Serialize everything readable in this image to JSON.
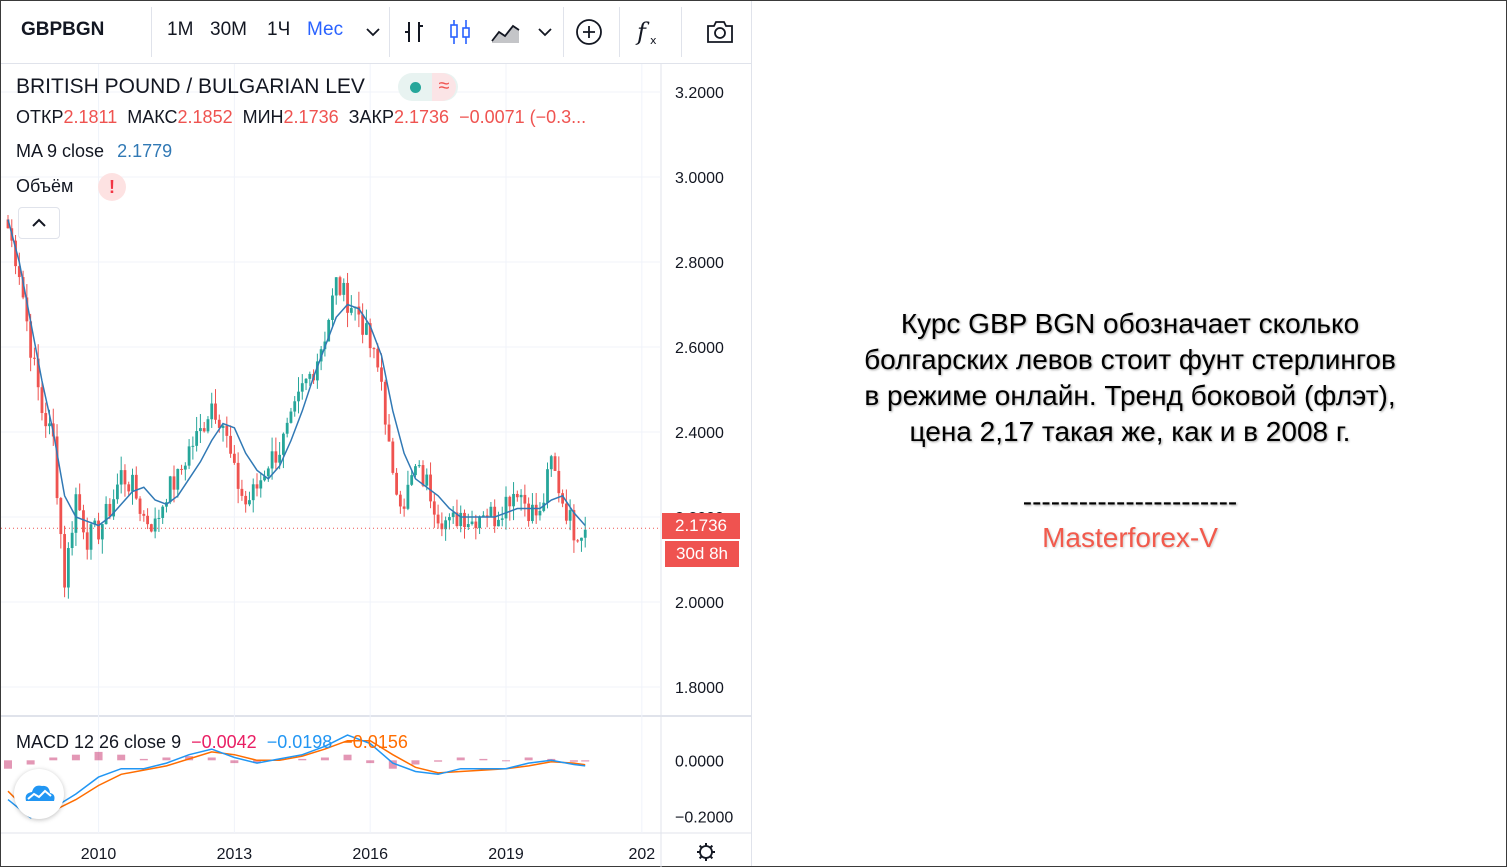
{
  "toolbar": {
    "symbol": "GBPBGN",
    "intervals": [
      "1М",
      "30М",
      "1Ч",
      "Мес"
    ],
    "active_interval": "Мес",
    "icons": [
      "chevron-down-icon",
      "bar-chart-icon",
      "candles-icon",
      "area-chart-icon",
      "chevron-down-icon",
      "add-compare-icon",
      "indicators-fx-icon",
      "camera-icon"
    ]
  },
  "legend": {
    "title": "BRITISH POUND / BULGARIAN LEV",
    "ohlc": [
      {
        "label": "ОТКР",
        "value": "2.1811"
      },
      {
        "label": "МАКС",
        "value": "2.1852"
      },
      {
        "label": "МИН",
        "value": "2.1736"
      },
      {
        "label": "ЗАКР",
        "value": "2.1736"
      }
    ],
    "change": "−0.0071 (−0.3...",
    "ma_label": "MA 9 close",
    "ma_value": "2.1779",
    "volume_label": "Объём",
    "macd_label": "MACD 12 26 close 9",
    "macd_hist": "−0.0042",
    "macd_line": "−0.0198",
    "macd_signal": "−0.0156"
  },
  "price_scale": {
    "labels": [
      "3.2000",
      "3.0000",
      "2.8000",
      "2.6000",
      "2.4000",
      "2.2000",
      "2.0000",
      "1.8000"
    ],
    "last_price": "2.1736",
    "countdown": "30d 8h"
  },
  "macd_scale": {
    "labels": [
      "0.0000",
      "−0.2000"
    ]
  },
  "time_axis": {
    "labels": [
      "2010",
      "2013",
      "2016",
      "2019",
      "202"
    ]
  },
  "colors": {
    "up": "#26a69a",
    "down": "#ef5350",
    "ma": "#3179b5",
    "macd": "#2196f3",
    "signal": "#ff6d00",
    "hist": "#c2185b",
    "brand": "#f25a4c"
  },
  "annotation": {
    "lines": [
      "Курс GBP BGN обозначает сколько",
      "болгарских левов стоит фунт стерлингов",
      "в режиме онлайн. Тренд боковой (флэт),",
      "цена 2,17 такая же, как и в 2008 г."
    ],
    "dashes": "-----------------------",
    "brand": "Masterforex-V"
  },
  "chart_data": [
    {
      "type": "line",
      "description": "Monthly close of GBP/BGN (candlestick chart, approximated), with MA 9 close",
      "x_range": [
        2007.9,
        2020.75
      ],
      "ylim": [
        1.74,
        3.34
      ],
      "x": [
        2008.0,
        2008.25,
        2008.5,
        2008.75,
        2009.0,
        2009.25,
        2009.5,
        2009.75,
        2010.0,
        2010.25,
        2010.5,
        2010.75,
        2011.0,
        2011.25,
        2011.5,
        2011.75,
        2012.0,
        2012.25,
        2012.5,
        2012.75,
        2013.0,
        2013.25,
        2013.5,
        2013.75,
        2014.0,
        2014.25,
        2014.5,
        2014.75,
        2015.0,
        2015.25,
        2015.5,
        2015.75,
        2016.0,
        2016.25,
        2016.5,
        2016.75,
        2017.0,
        2017.25,
        2017.5,
        2017.75,
        2018.0,
        2018.25,
        2018.5,
        2018.75,
        2019.0,
        2019.25,
        2019.5,
        2019.75,
        2020.0,
        2020.25,
        2020.5,
        2020.75
      ],
      "close": [
        2.88,
        2.78,
        2.6,
        2.45,
        2.38,
        2.05,
        2.25,
        2.15,
        2.17,
        2.22,
        2.3,
        2.27,
        2.2,
        2.18,
        2.26,
        2.29,
        2.36,
        2.4,
        2.47,
        2.42,
        2.3,
        2.23,
        2.27,
        2.33,
        2.36,
        2.42,
        2.5,
        2.55,
        2.63,
        2.75,
        2.71,
        2.68,
        2.6,
        2.52,
        2.28,
        2.24,
        2.31,
        2.28,
        2.21,
        2.18,
        2.21,
        2.19,
        2.22,
        2.2,
        2.24,
        2.27,
        2.22,
        2.2,
        2.33,
        2.24,
        2.17,
        2.17
      ],
      "ma": [
        2.9,
        2.8,
        2.66,
        2.52,
        2.4,
        2.25,
        2.2,
        2.19,
        2.18,
        2.2,
        2.23,
        2.26,
        2.27,
        2.24,
        2.23,
        2.25,
        2.29,
        2.33,
        2.38,
        2.42,
        2.41,
        2.35,
        2.31,
        2.29,
        2.32,
        2.38,
        2.45,
        2.53,
        2.6,
        2.67,
        2.7,
        2.69,
        2.65,
        2.58,
        2.45,
        2.35,
        2.29,
        2.27,
        2.25,
        2.22,
        2.2,
        2.2,
        2.2,
        2.2,
        2.21,
        2.22,
        2.22,
        2.22,
        2.24,
        2.25,
        2.21,
        2.18
      ],
      "last_price": 2.1736
    },
    {
      "type": "line",
      "description": "MACD 12 26 close 9 (approximated)",
      "ylim": [
        -0.235,
        0.09
      ],
      "x": [
        2008.0,
        2008.5,
        2009.0,
        2009.5,
        2010.0,
        2010.5,
        2011.0,
        2011.5,
        2012.0,
        2012.5,
        2013.0,
        2013.5,
        2014.0,
        2014.5,
        2015.0,
        2015.5,
        2016.0,
        2016.5,
        2017.0,
        2017.5,
        2018.0,
        2018.5,
        2019.0,
        2019.5,
        2020.0,
        2020.5,
        2020.75
      ],
      "macd": [
        -0.14,
        -0.205,
        -0.17,
        -0.12,
        -0.06,
        -0.03,
        -0.03,
        -0.01,
        0.02,
        0.04,
        0.01,
        -0.01,
        0.005,
        0.02,
        0.05,
        0.09,
        0.06,
        -0.01,
        -0.04,
        -0.05,
        -0.03,
        -0.03,
        -0.03,
        -0.01,
        0.0,
        -0.015,
        -0.0198
      ],
      "signal": [
        -0.11,
        -0.19,
        -0.18,
        -0.14,
        -0.09,
        -0.05,
        -0.035,
        -0.02,
        0.005,
        0.03,
        0.02,
        0.0,
        0.0,
        0.015,
        0.04,
        0.07,
        0.07,
        0.02,
        -0.025,
        -0.045,
        -0.04,
        -0.035,
        -0.03,
        -0.02,
        -0.005,
        -0.01,
        -0.0156
      ],
      "histogram": [
        -0.03,
        -0.015,
        0.01,
        0.02,
        0.03,
        0.02,
        0.005,
        0.01,
        0.015,
        0.01,
        -0.01,
        -0.01,
        0.005,
        0.005,
        0.01,
        0.02,
        -0.01,
        -0.03,
        -0.015,
        -0.005,
        0.01,
        0.005,
        0.0,
        0.01,
        0.005,
        -0.005,
        -0.0042
      ]
    }
  ]
}
